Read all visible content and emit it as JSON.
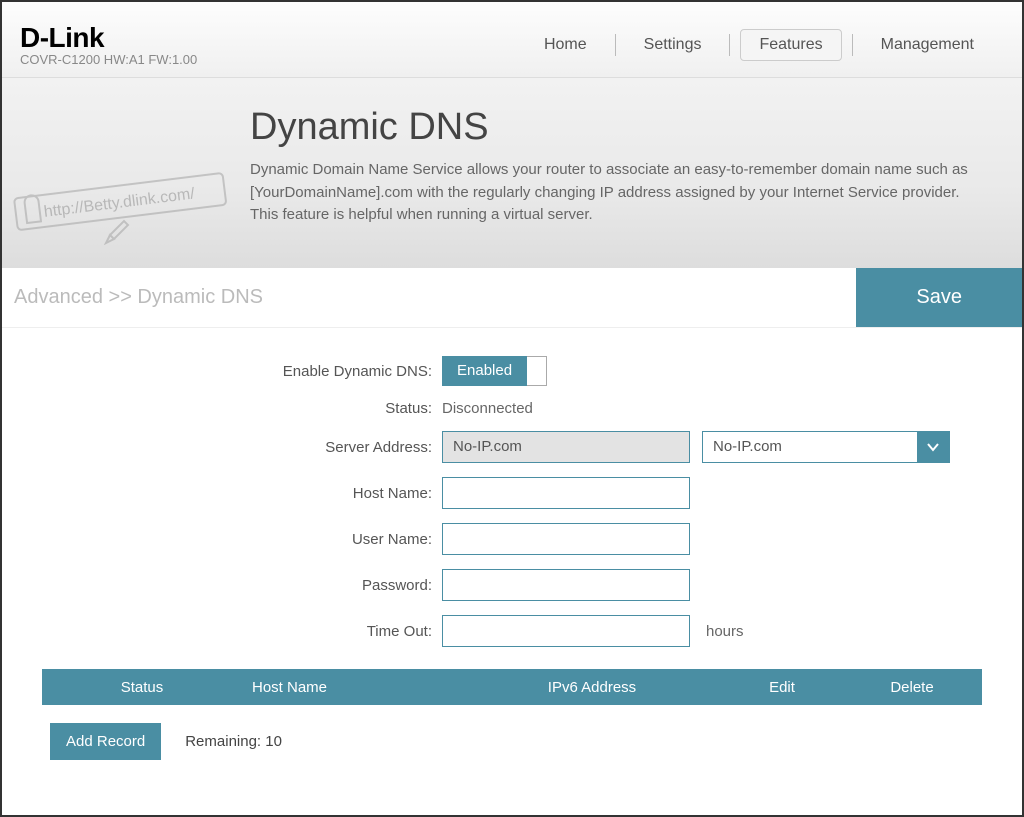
{
  "brand": {
    "logo": "D-Link",
    "model": "COVR-C1200 HW:A1 FW:1.00"
  },
  "nav": {
    "home": "Home",
    "settings": "Settings",
    "features": "Features",
    "management": "Management"
  },
  "hero": {
    "title": "Dynamic DNS",
    "description": "Dynamic Domain Name Service allows your router to associate an easy-to-remember domain name such as [YourDomainName].com with the regularly changing IP address assigned by your Internet Service provider. This feature is helpful when running a virtual server.",
    "graphic_text": "http://Betty.dlink.com/"
  },
  "breadcrumb": "Advanced >> Dynamic DNS",
  "save_label": "Save",
  "form": {
    "enable_label": "Enable Dynamic DNS:",
    "enable_state": "Enabled",
    "status_label": "Status:",
    "status_value": "Disconnected",
    "server_label": "Server Address:",
    "server_value": "No-IP.com",
    "server_selected": "No-IP.com",
    "host_label": "Host Name:",
    "host_value": "",
    "user_label": "User Name:",
    "user_value": "",
    "password_label": "Password:",
    "password_value": "",
    "timeout_label": "Time Out:",
    "timeout_value": "",
    "timeout_unit": "hours"
  },
  "table": {
    "headers": {
      "status": "Status",
      "hostname": "Host Name",
      "ipv6": "IPv6 Address",
      "edit": "Edit",
      "delete": "Delete"
    }
  },
  "add_record_label": "Add Record",
  "remaining": "Remaining: 10"
}
